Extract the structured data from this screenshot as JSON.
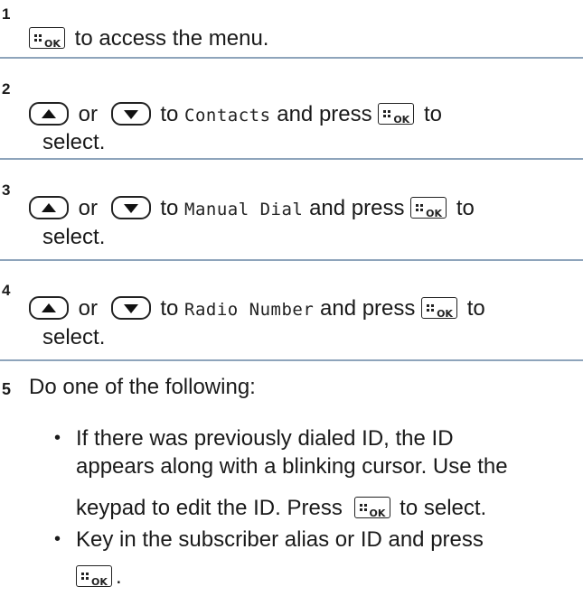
{
  "icons": {
    "ok_key": "ok-key-icon",
    "up_key": "up-arrow-key-icon",
    "down_key": "down-arrow-key-icon"
  },
  "steps": [
    {
      "number": "1",
      "text_after_ok": "to access the menu."
    },
    {
      "number": "2",
      "or": "or",
      "to": "to",
      "menu_item": "Contacts",
      "and_press": "and press",
      "to_end": "to",
      "select": "select."
    },
    {
      "number": "3",
      "or": "or",
      "to": "to",
      "menu_item": "Manual Dial",
      "and_press": "and press",
      "to_end": "to",
      "select": "select."
    },
    {
      "number": "4",
      "or": "or",
      "to": "to",
      "menu_item": "Radio Number",
      "and_press": "and press",
      "to_end": "to",
      "select": "select."
    },
    {
      "number": "5",
      "intro": "Do one of the following:",
      "bullets": [
        {
          "symbol": "•",
          "line1": "If there was previously dialed ID, the ID",
          "line2": "appears along with a blinking cursor. Use the",
          "line3_pre": "keypad to edit the ID. Press",
          "line3_post": "to select."
        },
        {
          "symbol": "•",
          "line1": "Key in the subscriber alias or ID and press",
          "line2_post": "."
        }
      ]
    }
  ]
}
